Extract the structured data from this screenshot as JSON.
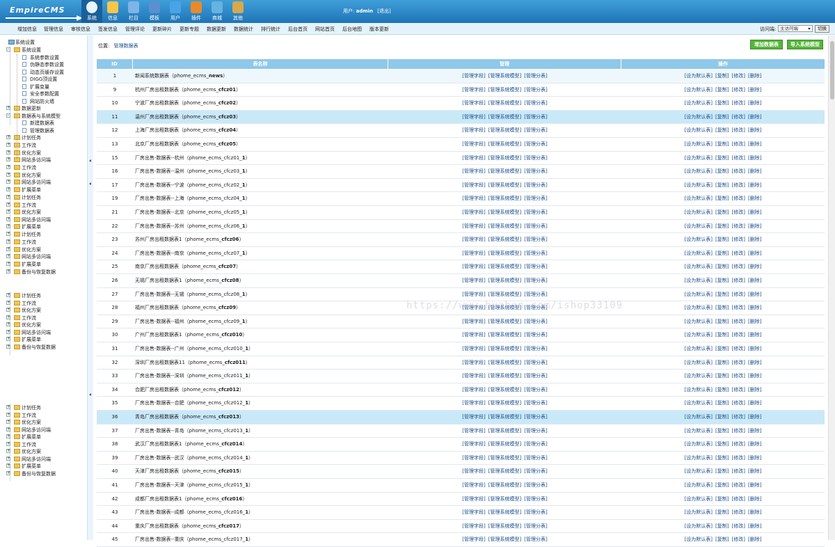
{
  "logo": {
    "text": "EmpireCMS"
  },
  "top_nav": [
    {
      "label": "系统",
      "icon": "globe-icon",
      "active": true
    },
    {
      "label": "信息",
      "icon": "pencil-icon"
    },
    {
      "label": "栏目",
      "icon": "folder-icon"
    },
    {
      "label": "模板",
      "icon": "template-icon"
    },
    {
      "label": "用户",
      "icon": "user-icon"
    },
    {
      "label": "插件",
      "icon": "plugin-icon"
    },
    {
      "label": "商城",
      "icon": "shop-icon"
    },
    {
      "label": "其他",
      "icon": "other-icon"
    }
  ],
  "user": {
    "prefix": "用户:",
    "name": "admin",
    "logout": "[退出]"
  },
  "menu": [
    "增加信息",
    "管理信息",
    "审核信息",
    "签发信息",
    "管理评论",
    "更新碎片",
    "更新专题",
    "数据更新",
    "数据统计",
    "排行统计",
    "后台首页",
    "网站首页",
    "后台地图",
    "版本更新"
  ],
  "access": {
    "label": "访问端:",
    "selected": "主访问端",
    "button": "切换"
  },
  "sidebar": {
    "root": "系统设置",
    "sys_settings": "系统设置",
    "sys_children": [
      "系统参数设置",
      "伪静态参数设置",
      "动态页缓存设置",
      "DIGG顶设置",
      "扩展变量",
      "安全参数配置",
      "网站防火墙"
    ],
    "data_update": "数据更新",
    "datatable_model": "数据表与系统模型",
    "dt_children": [
      "新建数据表",
      "管理数据表"
    ],
    "folders": [
      "计划任务",
      "工作流",
      "优化方案",
      "网站多访问端",
      "工作流",
      "优化方案",
      "网站多访问端",
      "扩展菜单",
      "计划任务",
      "工作流",
      "优化方案",
      "网站多访问端",
      "扩展菜单",
      "计划任务",
      "工作流",
      "优化方案",
      "网站多访问端",
      "扩展菜单",
      "备份与恢复数据"
    ],
    "folders2": [
      "计划任务",
      "工作流",
      "优化方案",
      "工作流",
      "优化方案",
      "网站多访问端",
      "扩展菜单",
      "备份与恢复数据"
    ],
    "folders3": [
      "计划任务",
      "工作流",
      "优化方案",
      "网站多访问端",
      "扩展菜单",
      "工作流",
      "优化方案",
      "网站多访问端",
      "扩展菜单",
      "备份与恢复数据"
    ]
  },
  "breadcrumb": {
    "prefix": "位置:",
    "link": "管理数据表"
  },
  "buttons": {
    "add": "增加数据表",
    "import": "导入系统模型"
  },
  "table": {
    "headers": [
      "ID",
      "表名称",
      "管理",
      "操作"
    ],
    "manage_links": [
      "[管理字段]",
      "[管理系统模型]",
      "[管理分表]"
    ],
    "op_links": [
      "[设为默认表]",
      "[复制]",
      "[修改]",
      "[删除]"
    ],
    "rows": [
      {
        "id": "1",
        "label": "新闻系统数据表（",
        "code": "phome_ecms_news",
        "tail": "）"
      },
      {
        "id": "9",
        "label": "杭州厂房出租数据表（",
        "code": "phome_ecms_cfcz01",
        "tail": "）"
      },
      {
        "id": "10",
        "label": "宁波厂房出租数据表（",
        "code": "phome_ecms_cfcz02",
        "tail": "）"
      },
      {
        "id": "11",
        "label": "温州厂房出租数据表（",
        "code": "phome_ecms_cfcz03",
        "tail": "）"
      },
      {
        "id": "12",
        "label": "上海厂房出租数据表（",
        "code": "phome_ecms_cfcz04",
        "tail": "）"
      },
      {
        "id": "13",
        "label": "北京厂房出租数据表（",
        "code": "phome_ecms_cfcz05",
        "tail": "）"
      },
      {
        "id": "15",
        "label": "厂房出售-数据表--杭州（",
        "code": "phome_ecms_cfcz01_1",
        "tail": "）"
      },
      {
        "id": "16",
        "label": "厂房出售-数据表--温州（",
        "code": "phome_ecms_cfcz03_1",
        "tail": "）"
      },
      {
        "id": "17",
        "label": "厂房出售-数据表--宁波（",
        "code": "phome_ecms_cfcz02_1",
        "tail": "）"
      },
      {
        "id": "19",
        "label": "厂房出售-数据表--上海（",
        "code": "phome_ecms_cfcz04_1",
        "tail": "）"
      },
      {
        "id": "21",
        "label": "厂房出售-数据表--北京（",
        "code": "phome_ecms_cfcz05_1",
        "tail": "）"
      },
      {
        "id": "22",
        "label": "厂房出售-数据表--苏州（",
        "code": "phome_ecms_cfcz06_1",
        "tail": "）"
      },
      {
        "id": "23",
        "label": "苏州厂房出租数据表1（",
        "code": "phome_ecms_cfcz06",
        "tail": "）"
      },
      {
        "id": "24",
        "label": "厂房出售-数据表--南京（",
        "code": "phome_ecms_cfcz07_1",
        "tail": "）"
      },
      {
        "id": "25",
        "label": "南京厂房出租数据表（",
        "code": "phome_ecms_cfcz07",
        "tail": "）"
      },
      {
        "id": "26",
        "label": "无锡厂房出租数据表1（",
        "code": "phome_ecms_cfcz08",
        "tail": "）"
      },
      {
        "id": "27",
        "label": "厂房出售-数据表--无锡（",
        "code": "phome_ecms_cfcz08_1",
        "tail": "）"
      },
      {
        "id": "28",
        "label": "福州厂房出租数据表（",
        "code": "phome_ecms_cfcz09",
        "tail": "）"
      },
      {
        "id": "29",
        "label": "厂房出售-数据表--福州（",
        "code": "phome_ecms_cfcz09_1",
        "tail": "）"
      },
      {
        "id": "30",
        "label": "广州厂房出租数据表1（",
        "code": "phome_ecms_cfcz010",
        "tail": "）"
      },
      {
        "id": "31",
        "label": "厂房出售-数据表--广州（",
        "code": "phome_ecms_cfcz010_1",
        "tail": "）"
      },
      {
        "id": "32",
        "label": "深圳厂房出租数据表11（",
        "code": "phome_ecms_cfcz011",
        "tail": "）"
      },
      {
        "id": "33",
        "label": "厂房出售-数据表--深圳（",
        "code": "phome_ecms_cfcz011_1",
        "tail": "）"
      },
      {
        "id": "34",
        "label": "合肥厂房出租数据表（",
        "code": "phome_ecms_cfcz012",
        "tail": "）"
      },
      {
        "id": "35",
        "label": "厂房出售-数据表--合肥（",
        "code": "phome_ecms_cfcz012_1",
        "tail": "）"
      },
      {
        "id": "36",
        "label": "青岛厂房出租数据表（",
        "code": "phome_ecms_cfcz013",
        "tail": "）"
      },
      {
        "id": "37",
        "label": "厂房出售-数据表--青岛（",
        "code": "phome_ecms_cfcz013_1",
        "tail": "）"
      },
      {
        "id": "38",
        "label": "武汉厂房出租数据表1（",
        "code": "phome_ecms_cfcz014",
        "tail": "）"
      },
      {
        "id": "39",
        "label": "厂房出售-数据表--武汉（",
        "code": "phome_ecms_cfcz014_1",
        "tail": "）"
      },
      {
        "id": "40",
        "label": "天津厂房出租数据表（",
        "code": "phome_ecms_cfcz015",
        "tail": "）"
      },
      {
        "id": "41",
        "label": "厂房出售-数据表--天津（",
        "code": "phome_ecms_cfcz015_1",
        "tail": "）"
      },
      {
        "id": "42",
        "label": "成都厂房出租数据表1（",
        "code": "phome_ecms_cfcz016",
        "tail": "）"
      },
      {
        "id": "43",
        "label": "厂房出售-数据表--成都（",
        "code": "phome_ecms_cfcz016_1",
        "tail": "）"
      },
      {
        "id": "44",
        "label": "重庆厂房出租数据表（",
        "code": "phome_ecms_cfcz017",
        "tail": "）"
      },
      {
        "id": "45",
        "label": "厂房出售-数据表--重庆（",
        "code": "phome_ecms_cfcz017_1",
        "tail": "）"
      }
    ]
  },
  "watermark": "https://www.huzhan.com/ishop33109"
}
